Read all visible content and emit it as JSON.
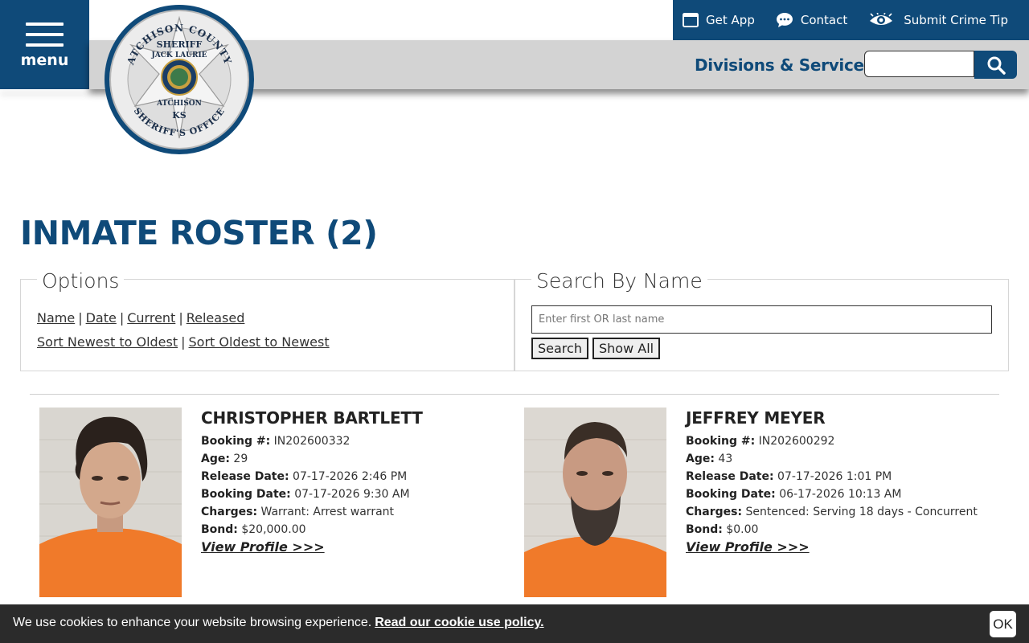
{
  "header": {
    "menu_label": "menu",
    "get_app": "Get App",
    "contact": "Contact",
    "submit_tip": "Submit Crime Tip",
    "divisions": "Divisions & Services",
    "badge_text": {
      "top": "ATCHISON COUNTY",
      "sheriff": "SHERIFF",
      "name": "JACK LAURIE",
      "city": "ATCHISON",
      "state": "KS",
      "bottom": "SHERIFF'S OFFICE"
    }
  },
  "title": "INMATE ROSTER (2)",
  "options": {
    "legend": "Options",
    "filters": [
      "Name",
      "Date",
      "Current",
      "Released"
    ],
    "sorts": [
      "Sort Newest to Oldest",
      "Sort Oldest to Newest"
    ]
  },
  "search": {
    "legend": "Search By Name",
    "placeholder": "Enter first OR last name",
    "search_label": "Search",
    "show_all_label": "Show All"
  },
  "labels": {
    "booking_no": "Booking #:",
    "age": "Age:",
    "release_date": "Release Date:",
    "booking_date": "Booking Date:",
    "charges": "Charges:",
    "bond": "Bond:",
    "view_profile": "View Profile >>>"
  },
  "inmates": [
    {
      "name": "CHRISTOPHER BARTLETT",
      "booking_no": "IN202600332",
      "age": "29",
      "release_date": "07-17-2026 2:46 PM",
      "booking_date": "07-17-2026 9:30 AM",
      "charges": "Warrant: Arrest warrant",
      "bond": "$20,000.00"
    },
    {
      "name": "JEFFREY MEYER",
      "booking_no": "IN202600292",
      "age": "43",
      "release_date": "07-17-2026 1:01 PM",
      "booking_date": "06-17-2026 10:13 AM",
      "charges": "Sentenced: Serving 18 days - Concurrent",
      "bond": "$0.00"
    }
  ],
  "cookie": {
    "text": "We use cookies to enhance your website browsing experience.",
    "link": "Read our cookie use policy.",
    "ok": "OK"
  },
  "colors": {
    "brand": "#0f4a79",
    "band": "#d3d3d3",
    "cookie_bg": "#2b2b2b"
  },
  "icons": [
    "menu-icon",
    "phone-app-icon",
    "chat-bubble-icon",
    "eye-icon",
    "search-icon"
  ]
}
